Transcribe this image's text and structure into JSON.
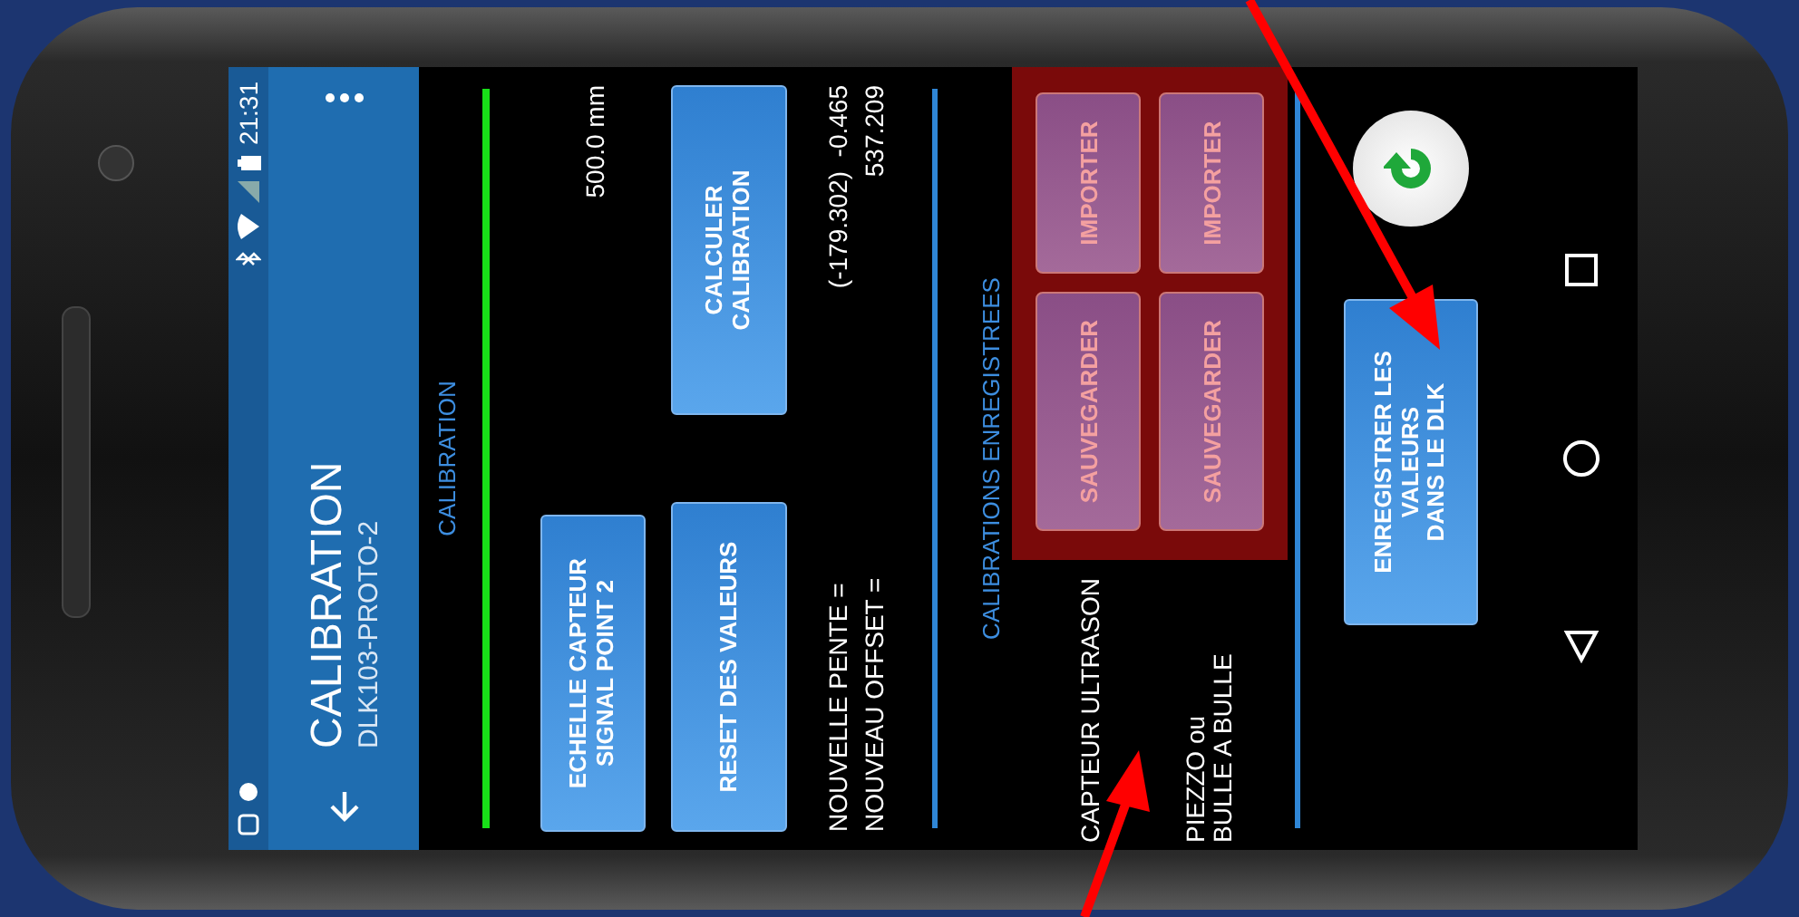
{
  "status_bar": {
    "time": "21:31"
  },
  "toolbar": {
    "title": "CALIBRATION",
    "subtitle": "DLK103-PROTO-2"
  },
  "section_title": "CALIBRATION",
  "scale_row": {
    "button": "ECHELLE CAPTEUR\nSIGNAL POINT 2",
    "reading": "500.0 mm"
  },
  "actions": [
    "RESET DES VALEURS",
    "CALCULER\nCALIBRATION"
  ],
  "results": [
    {
      "label": "NOUVELLE PENTE =",
      "value": "(-179.302)  -0.465"
    },
    {
      "label": "NOUVEAU OFFSET =",
      "value": "537.209"
    }
  ],
  "saved": {
    "title": "CALIBRATIONS ENREGISTREES",
    "rows": [
      {
        "label": "CAPTEUR ULTRASON",
        "save": "SAUVEGARDER",
        "import": "IMPORTER"
      },
      {
        "label": "PIEZZO ou\nBULLE A BULLE",
        "save": "SAUVEGARDER",
        "import": "IMPORTER"
      }
    ]
  },
  "write_button": "ENREGISTRER LES\nVALEURS\nDANS LE DLK"
}
